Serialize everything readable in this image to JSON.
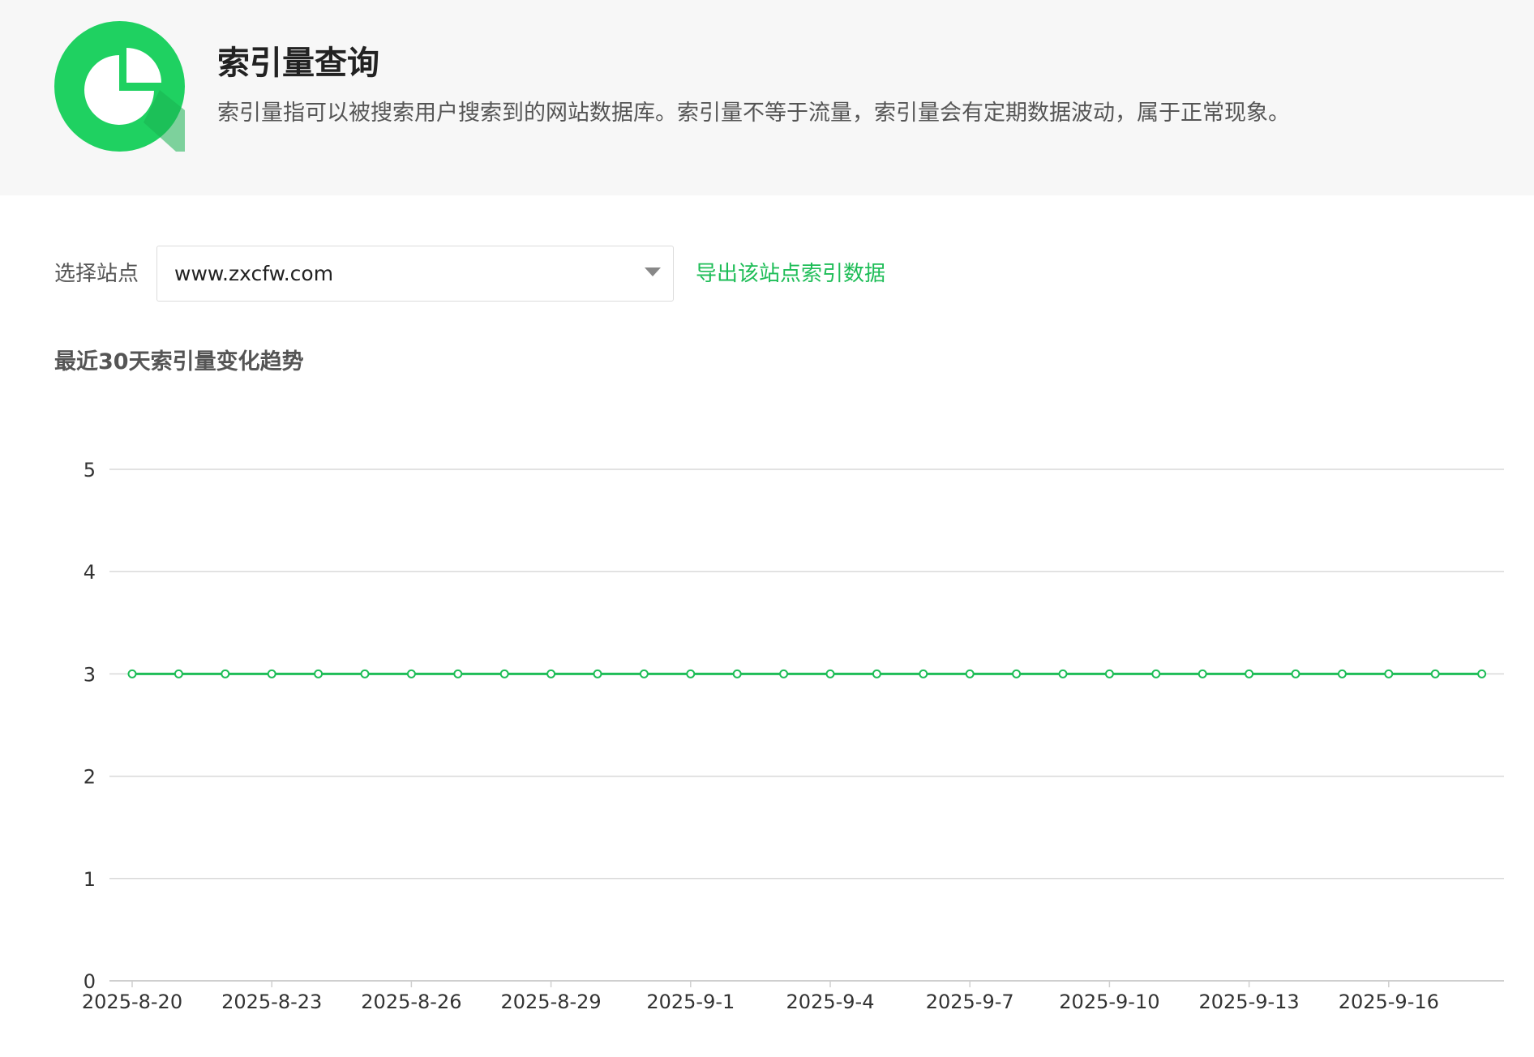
{
  "header": {
    "title": "索引量查询",
    "description": "索引量指可以被搜索用户搜索到的网站数据库。索引量不等于流量，索引量会有定期数据波动，属于正常现象。",
    "logo_icon": "pie-chart-icon",
    "accent_color": "#1fd161"
  },
  "controls": {
    "site_label": "选择站点",
    "site_value": "www.zxcfw.com",
    "export_label": "导出该站点索引数据",
    "link_color": "#1ebd57"
  },
  "chart_title": "最近30天索引量变化趋势",
  "chart_data": {
    "type": "line",
    "title": "最近30天索引量变化趋势",
    "xlabel": "",
    "ylabel": "",
    "ylim": [
      0,
      5
    ],
    "yticks": [
      "0",
      "1",
      "2",
      "3",
      "4",
      "5"
    ],
    "x_tick_labels": [
      "2025-8-20",
      "2025-8-23",
      "2025-8-26",
      "2025-8-29",
      "2025-9-1",
      "2025-9-4",
      "2025-9-7",
      "2025-9-10",
      "2025-9-13",
      "2025-9-16"
    ],
    "x": [
      "2025-8-20",
      "2025-8-21",
      "2025-8-22",
      "2025-8-23",
      "2025-8-24",
      "2025-8-25",
      "2025-8-26",
      "2025-8-27",
      "2025-8-28",
      "2025-8-29",
      "2025-8-30",
      "2025-8-31",
      "2025-9-1",
      "2025-9-2",
      "2025-9-3",
      "2025-9-4",
      "2025-9-5",
      "2025-9-6",
      "2025-9-7",
      "2025-9-8",
      "2025-9-9",
      "2025-9-10",
      "2025-9-11",
      "2025-9-12",
      "2025-9-13",
      "2025-9-14",
      "2025-9-15",
      "2025-9-16",
      "2025-9-17",
      "2025-9-18"
    ],
    "series": [
      {
        "values": [
          3,
          3,
          3,
          3,
          3,
          3,
          3,
          3,
          3,
          3,
          3,
          3,
          3,
          3,
          3,
          3,
          3,
          3,
          3,
          3,
          3,
          3,
          3,
          3,
          3,
          3,
          3,
          3,
          3,
          3
        ],
        "color": "#1ebd57"
      }
    ],
    "grid": true,
    "legend": "none"
  }
}
